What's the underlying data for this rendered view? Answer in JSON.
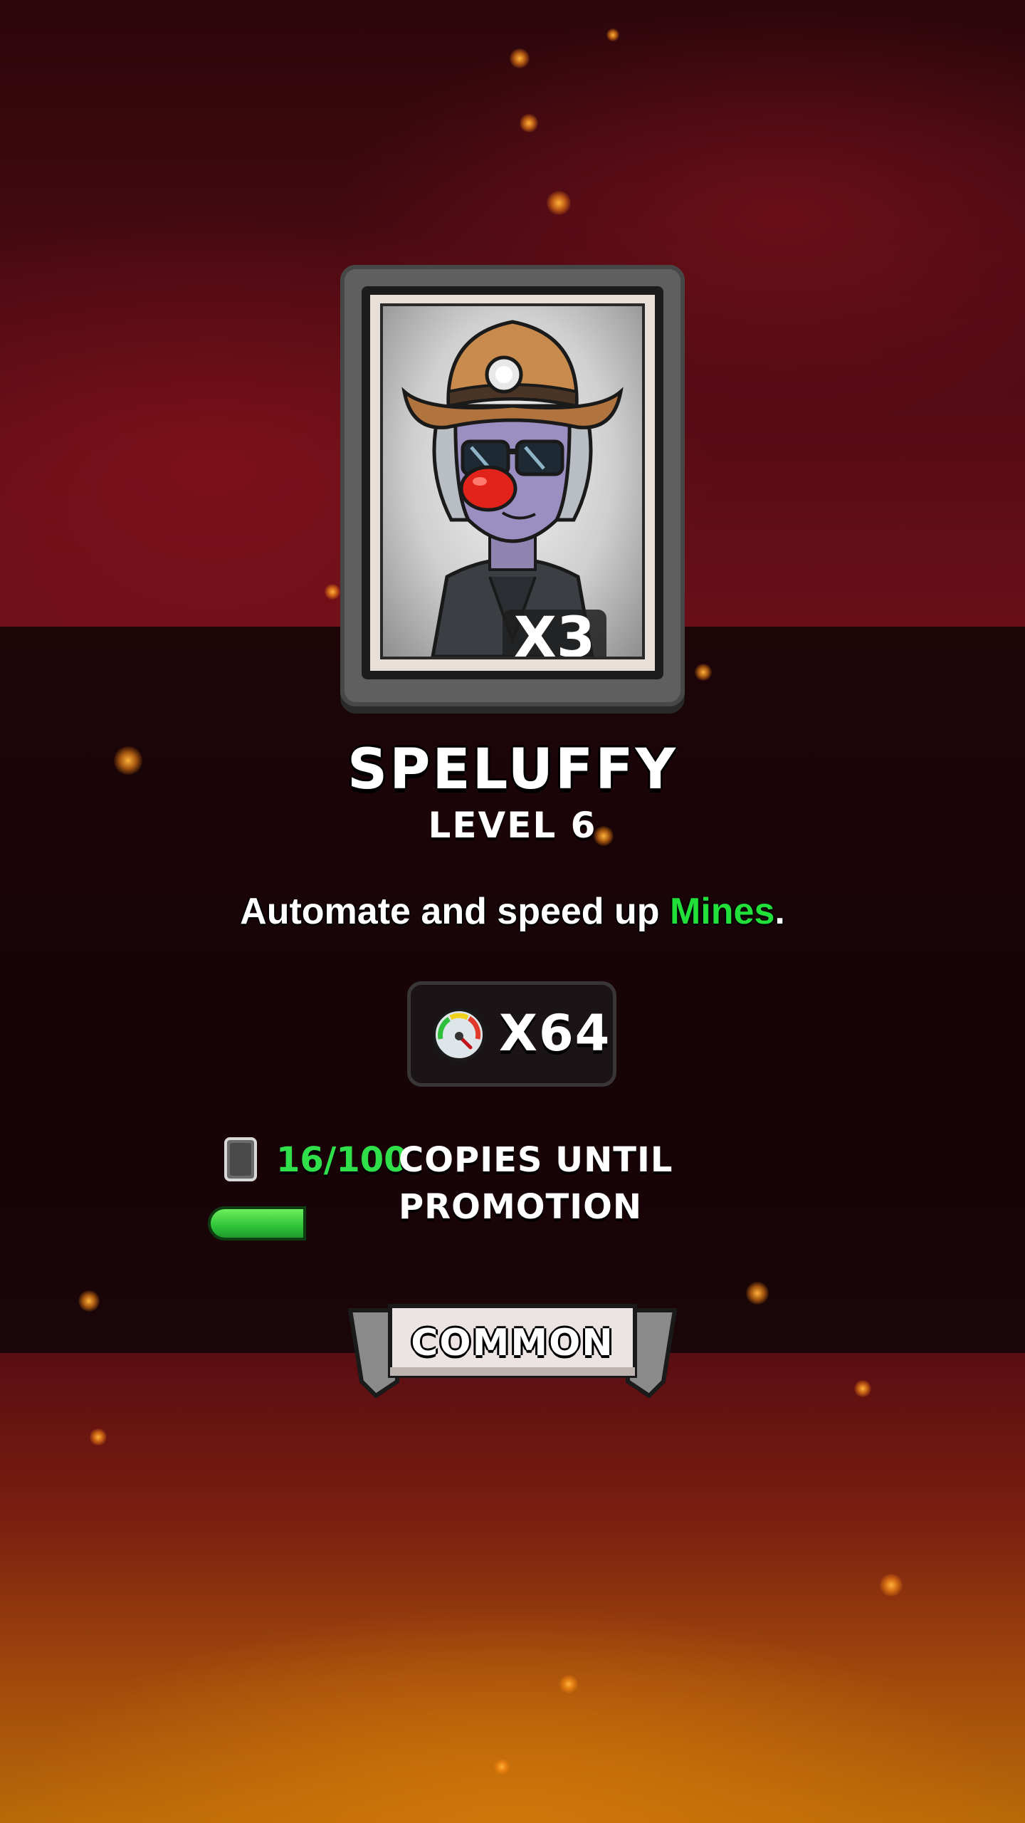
{
  "card": {
    "multiplier": "X3",
    "portrait_icon": "speluffy-portrait-icon"
  },
  "character": {
    "name": "SPELUFFY",
    "level": "LEVEL 6"
  },
  "description": {
    "prefix": "Automate and speed up ",
    "highlight": "Mines",
    "suffix": "."
  },
  "boost": {
    "icon": "speedometer-icon",
    "value": "X64"
  },
  "promotion": {
    "icon": "card-copy-icon",
    "count": "16/100",
    "label": "COPIES UNTIL PROMOTION",
    "progress": 0.16
  },
  "rarity": {
    "label": "COMMON"
  },
  "colors": {
    "highlight_green": "#22e03a",
    "progress_green": "#2fc33a",
    "ember_orange": "#ffb13a"
  }
}
